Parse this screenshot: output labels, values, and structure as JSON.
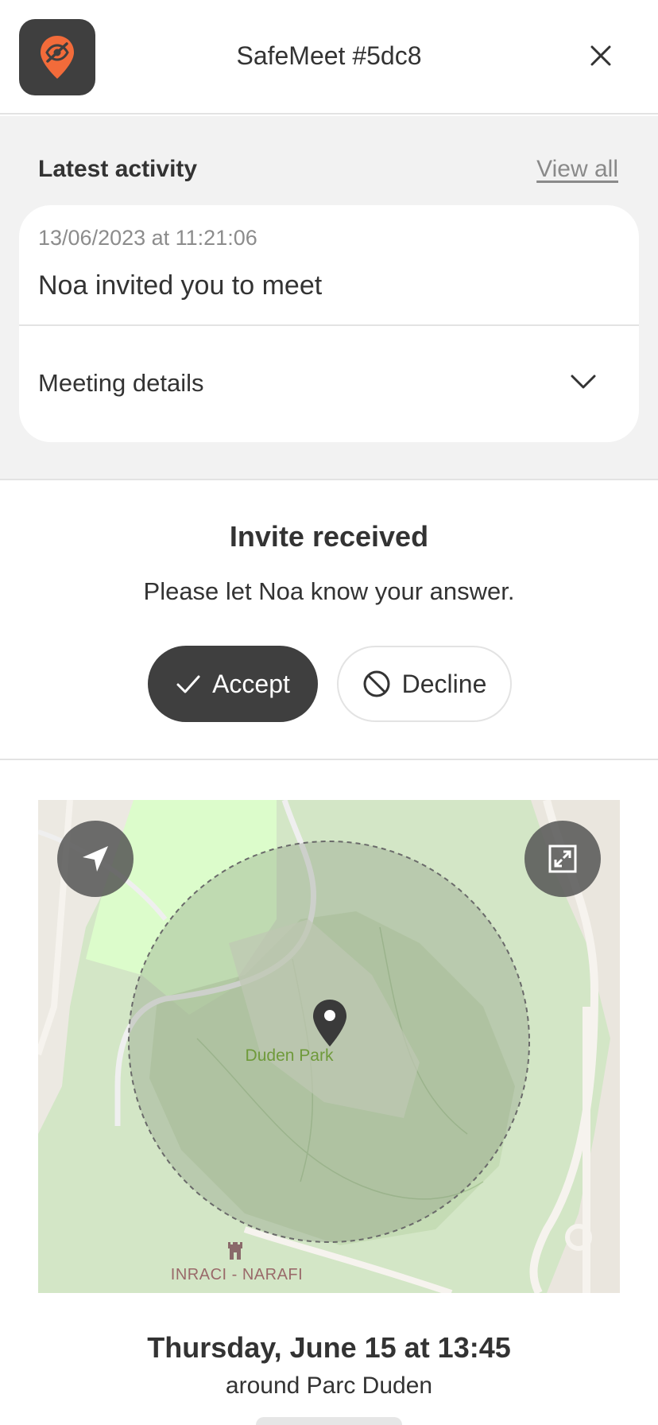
{
  "header": {
    "title": "SafeMeet #5dc8",
    "app_icon": "hidden-location-pin-icon",
    "close_icon": "close-icon"
  },
  "activity": {
    "heading": "Latest activity",
    "view_all_label": "View all",
    "item": {
      "timestamp": "13/06/2023 at 11:21:06",
      "text": "Noa invited you to meet"
    },
    "details_label": "Meeting details",
    "details_icon": "chevron-down-icon"
  },
  "invite": {
    "title": "Invite received",
    "subtitle": "Please let Noa know your answer.",
    "accept_label": "Accept",
    "accept_icon": "check-icon",
    "decline_label": "Decline",
    "decline_icon": "block-icon"
  },
  "map": {
    "park_label": "Duden Park",
    "poi_label": "INRACI - NARAFI",
    "locate_icon": "navigation-arrow-icon",
    "expand_icon": "fullscreen-icon",
    "pin_icon": "location-pin-icon",
    "poi_icon": "castle-icon"
  },
  "meeting": {
    "when": "Thursday, June 15 at 13:45",
    "where": "around Parc Duden"
  },
  "colors": {
    "accent": "#f26b3a",
    "dark": "#3f3f3f",
    "section_bg": "#f2f2f2",
    "map_green": "#d7e7cc",
    "park_label": "#6f9a3b"
  }
}
